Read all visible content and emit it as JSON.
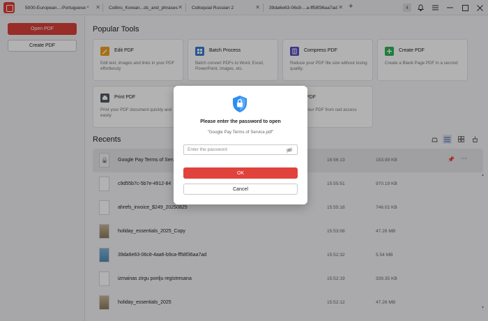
{
  "tabs": [
    {
      "label": "5000-European...-Portuguese *"
    },
    {
      "label": "Collins_Korean...ds_and_phrases"
    },
    {
      "label": "Colloquial Russian 2"
    },
    {
      "label": "39da6e63-06c8-...a-ff58f36aa7ad"
    }
  ],
  "titlebar": {
    "badge": "4"
  },
  "sidebar": {
    "open_label": "Open PDF",
    "create_label": "Create PDF"
  },
  "popular_tools": {
    "title": "Popular Tools",
    "items": [
      {
        "title": "Edit PDF",
        "desc": "Edit text, images and links in your PDF effortlessly",
        "icon": "edit-icon",
        "color": "#f0a020"
      },
      {
        "title": "Batch Process",
        "desc": "Batch convert PDFs to Word, Excel, PowerPoint, images, etc.",
        "icon": "batch-icon",
        "color": "#3a7bd5"
      },
      {
        "title": "Compress PDF",
        "desc": "Reduce your PDF file size without losing quality.",
        "icon": "compress-icon",
        "color": "#5b4fc4"
      },
      {
        "title": "Create PDF",
        "desc": "Create a Blank Page PDF in a second",
        "icon": "create-icon",
        "color": "#2fb556"
      },
      {
        "title": "Print PDF",
        "desc": "Print your PDF document quickly and easily",
        "icon": "print-icon",
        "color": "#555a66"
      },
      {
        "title": "ncrypt PDF",
        "desc": "protect your PDF from ced access",
        "icon": "encrypt-icon",
        "color": "#3a7bd5"
      }
    ]
  },
  "recents": {
    "title": "Recents",
    "rows": [
      {
        "name": "Google Pay Terms of Service.pdf",
        "time": "16:56:13",
        "size": "153.99 KB",
        "thumb": "lock"
      },
      {
        "name": "c9d55b7c-5b7e-4912-84",
        "time": "15:55:51",
        "size": "970.19 KB",
        "thumb": "doc"
      },
      {
        "name": "ahrefs_invoice_$249_20250825",
        "time": "15:55:18",
        "size": "746.02 KB",
        "thumb": "doc"
      },
      {
        "name": "holiday_essentials_2025_Copy",
        "time": "15:53:08",
        "size": "47.26 MB",
        "thumb": "photo"
      },
      {
        "name": "39da6e63-06c8-4aa6-b9ca-ff58f36aa7ad",
        "time": "15:52:32",
        "size": "5.54 MB",
        "thumb": "img"
      },
      {
        "name": "izmainas zirgu ponlju registresana",
        "time": "15:52:19",
        "size": "339.35 KB",
        "thumb": "doc"
      },
      {
        "name": "holiday_essentials_2025",
        "time": "15:52:12",
        "size": "47.26 MB",
        "thumb": "photo"
      }
    ]
  },
  "dialog": {
    "title": "Please enter the password to open",
    "filename": "\"Google Pay Terms of Service.pdf\"",
    "placeholder": "Enter the password",
    "ok_label": "OK",
    "cancel_label": "Cancel",
    "accent": "#e0423c"
  }
}
